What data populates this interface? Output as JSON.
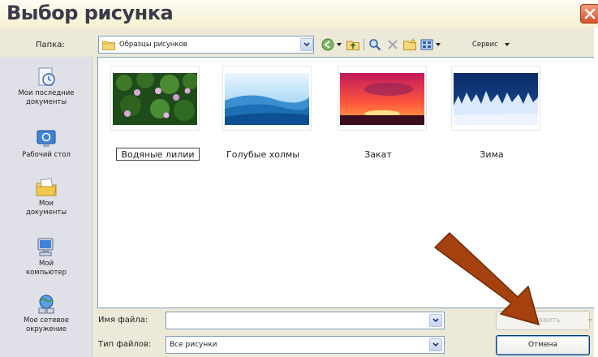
{
  "dialog": {
    "title": "Выбор рисунка",
    "lookin_label": "Папка:",
    "lookin_value": "Образцы рисунков",
    "tools_label": "Сервис",
    "places": [
      {
        "label": "Мои последние\nдокументы",
        "icon": "recent-documents-icon"
      },
      {
        "label": "Рабочий стол",
        "icon": "desktop-icon"
      },
      {
        "label": "Мои\nдокументы",
        "icon": "my-documents-icon"
      },
      {
        "label": "Мой\nкомпьютер",
        "icon": "my-computer-icon"
      },
      {
        "label": "Мое сетевое\nокружение",
        "icon": "network-places-icon"
      }
    ],
    "files": [
      {
        "name": "Водяные лилии",
        "thumb": "water-lilies-thumbnail",
        "selected": true
      },
      {
        "name": "Голубые холмы",
        "thumb": "blue-hills-thumbnail",
        "selected": false
      },
      {
        "name": "Закат",
        "thumb": "sunset-thumbnail",
        "selected": false
      },
      {
        "name": "Зима",
        "thumb": "winter-thumbnail",
        "selected": false
      }
    ],
    "filename_label": "Имя файла:",
    "filename_value": "",
    "filetype_label": "Тип файлов:",
    "filetype_value": "Все рисунки",
    "insert_label": "Вставить",
    "cancel_label": "Отмена"
  },
  "colors": {
    "annotation_arrow": "#a5400f",
    "close_button": "#d8522e",
    "field_border": "#7f9db9"
  }
}
